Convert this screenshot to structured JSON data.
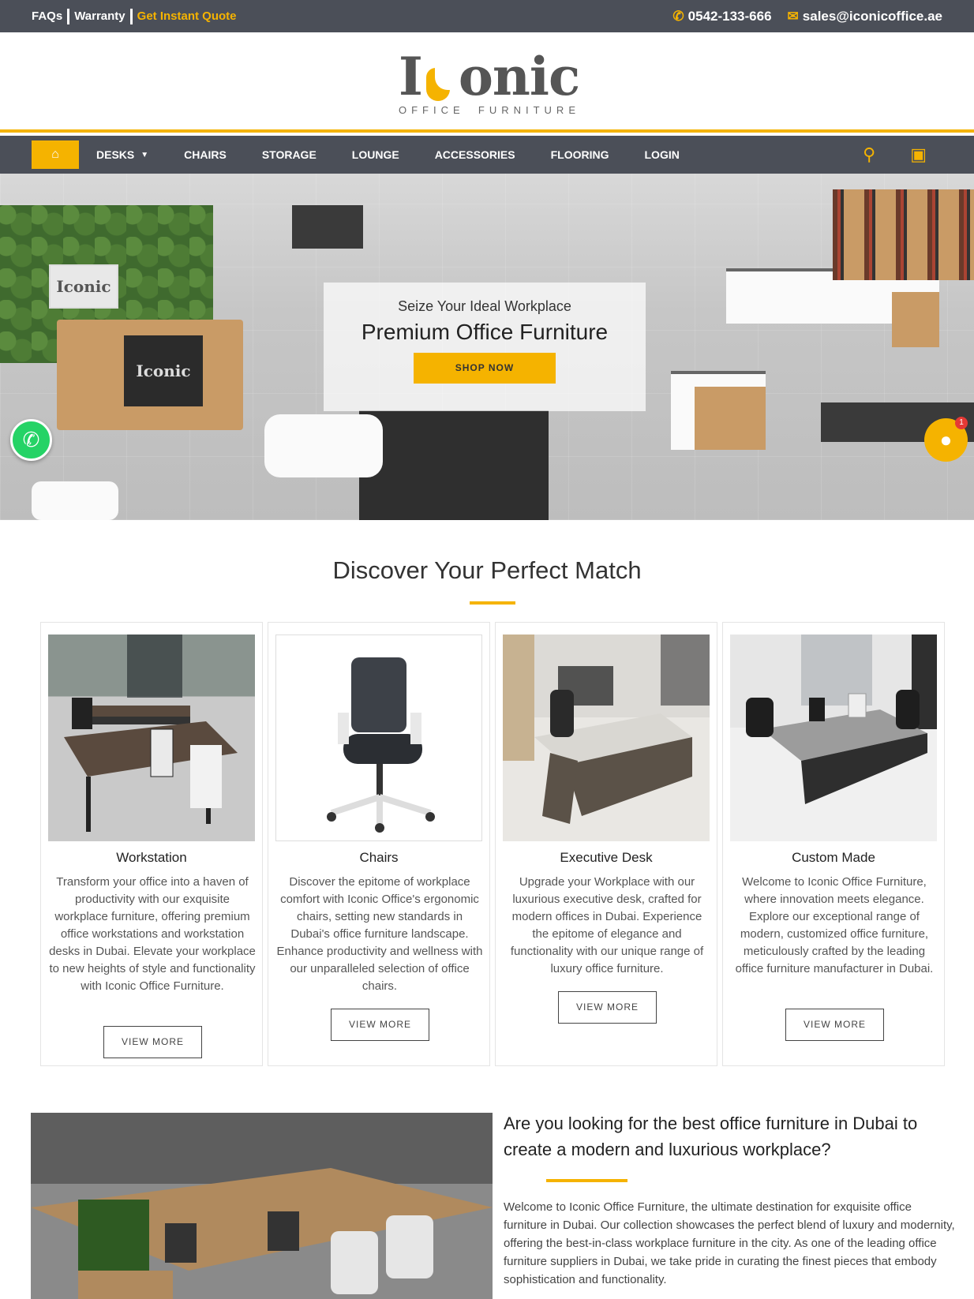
{
  "topbar": {
    "faqs": "FAQs",
    "warranty": "Warranty",
    "quote": "Get Instant Quote",
    "phone": "0542-133-666",
    "email": "sales@iconicoffice.ae"
  },
  "logo": {
    "word_start": "I",
    "word_end": "onic",
    "sub_left": "OFFICE",
    "sub_right": "FURNITURE"
  },
  "nav": {
    "items": [
      "DESKS",
      "CHAIRS",
      "STORAGE",
      "LOUNGE",
      "ACCESSORIES",
      "FLOORING",
      "LOGIN"
    ]
  },
  "hero": {
    "kicker": "Seize Your Ideal Workplace",
    "title": "Premium Office Furniture",
    "button": "SHOP NOW",
    "sign_text": "Iconic",
    "reception_text": "Iconic"
  },
  "chat": {
    "badge": "1"
  },
  "section": {
    "title": "Discover Your Perfect Match"
  },
  "cards": [
    {
      "name": "Workstation",
      "desc": "Transform your office into a haven of productivity with our exquisite workplace furniture, offering premium office workstations and workstation desks in Dubai. Elevate your workplace to new heights of style and functionality with Iconic Office Furniture.",
      "button": "VIEW MORE"
    },
    {
      "name": "Chairs",
      "desc": "Discover the epitome of workplace comfort with Iconic Office's ergonomic chairs, setting new standards in Dubai's office furniture landscape. Enhance productivity and wellness with our unparalleled selection of office chairs.",
      "button": "VIEW MORE"
    },
    {
      "name": "Executive Desk",
      "desc": "Upgrade your Workplace with our luxurious executive desk, crafted for modern offices in Dubai. Experience the epitome of elegance and functionality with our unique range of luxury office furniture.",
      "button": "VIEW MORE"
    },
    {
      "name": "Custom Made",
      "desc": "Welcome to Iconic Office Furniture, where innovation meets elegance. Explore our exceptional range of modern, customized office furniture, meticulously crafted by the leading office furniture manufacturer in Dubai.",
      "button": "VIEW MORE"
    }
  ],
  "about": {
    "heading": "Are you looking for the best office furniture in Dubai to create a modern and luxurious workplace?",
    "text": "Welcome to Iconic Office Furniture, the ultimate destination for exquisite office furniture in Dubai. Our collection showcases the perfect blend of luxury and modernity, offering the best-in-class workplace furniture in the city. As one of the leading office furniture suppliers in Dubai, we take pride in curating the finest pieces that embody sophistication and functionality."
  },
  "colors": {
    "accent": "#f5b300",
    "bar": "#4b4f58",
    "whatsapp": "#25d366"
  },
  "icons": {
    "phone": "phone-icon",
    "email": "envelope-icon",
    "home": "home-icon",
    "search": "search-icon",
    "cart": "shopping-bag-icon",
    "whatsapp": "whatsapp-icon",
    "chat": "chat-icon"
  }
}
